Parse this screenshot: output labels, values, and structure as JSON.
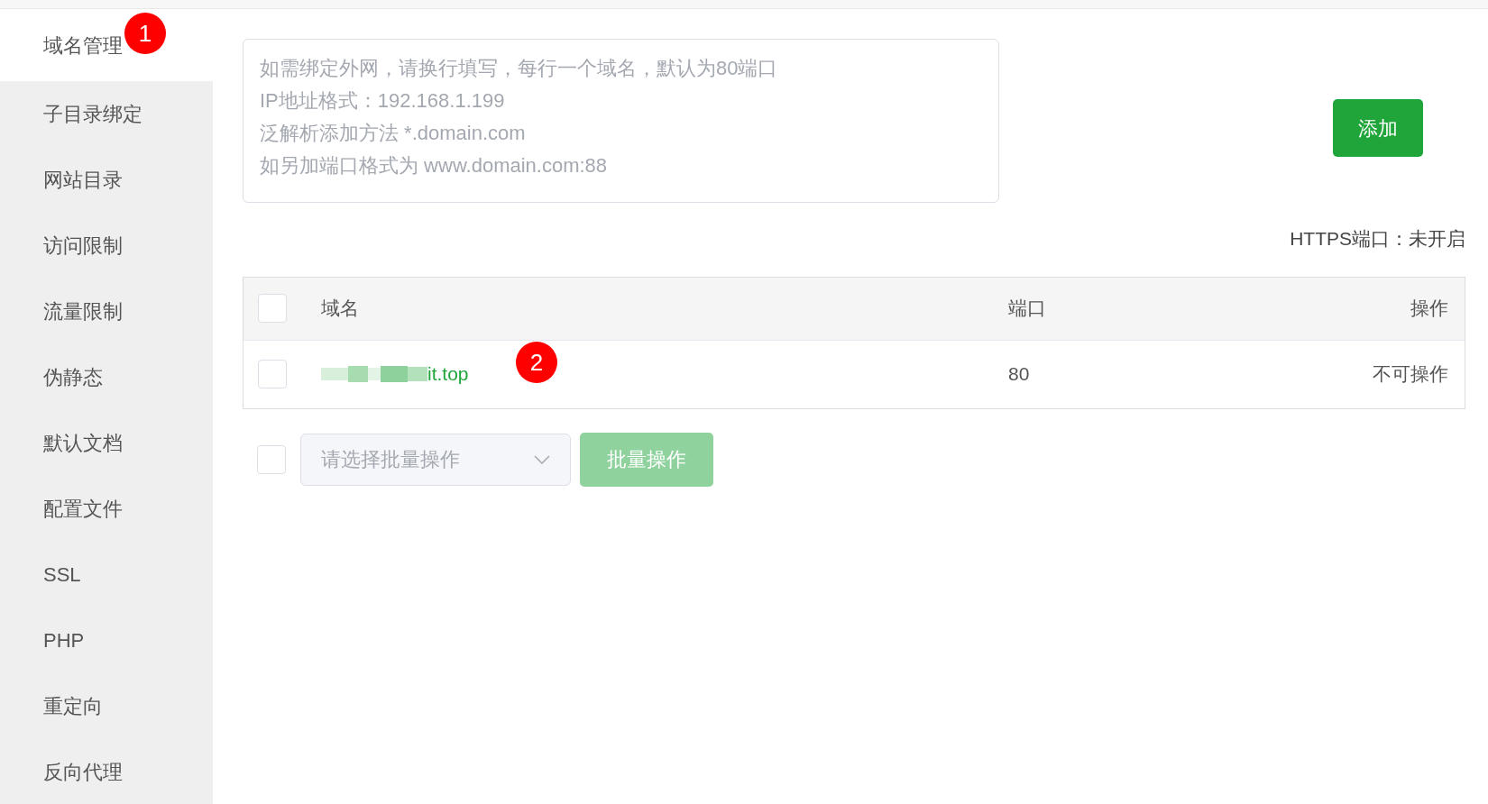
{
  "sidebar": {
    "items": [
      {
        "label": "域名管理",
        "selected": true
      },
      {
        "label": "子目录绑定",
        "selected": false
      },
      {
        "label": "网站目录",
        "selected": false
      },
      {
        "label": "访问限制",
        "selected": false
      },
      {
        "label": "流量限制",
        "selected": false
      },
      {
        "label": "伪静态",
        "selected": false
      },
      {
        "label": "默认文档",
        "selected": false
      },
      {
        "label": "配置文件",
        "selected": false
      },
      {
        "label": "SSL",
        "selected": false
      },
      {
        "label": "PHP",
        "selected": false
      },
      {
        "label": "重定向",
        "selected": false
      },
      {
        "label": "反向代理",
        "selected": false
      }
    ]
  },
  "domain_input": {
    "placeholder": "如需绑定外网，请换行填写，每行一个域名，默认为80端口\nIP地址格式：192.168.1.199\n泛解析添加方法 *.domain.com\n如另加端口格式为 www.domain.com:88"
  },
  "add_button": "添加",
  "https_port": "HTTPS端口：未开启",
  "table": {
    "header_checked": false,
    "columns": [
      "域名",
      "端口",
      "操作"
    ],
    "rows": [
      {
        "checked": false,
        "domain": "it.top",
        "domain_redacted": true,
        "port": "80",
        "action": "不可操作"
      }
    ]
  },
  "batch": {
    "checked": false,
    "select_placeholder": "请选择批量操作",
    "button": "批量操作",
    "button_disabled": true
  },
  "annotations": [
    {
      "label": "1"
    },
    {
      "label": "2"
    }
  ]
}
